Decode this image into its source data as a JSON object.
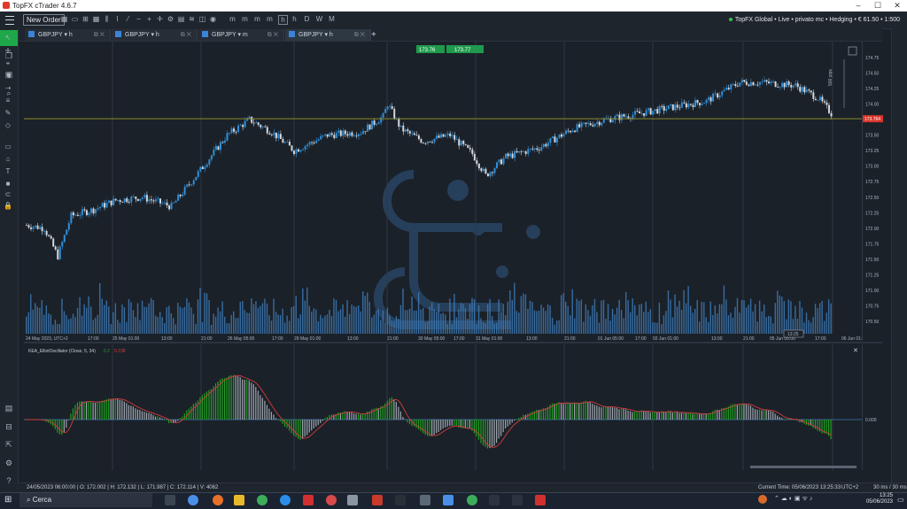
{
  "window": {
    "title": "TopFX cTrader 4.6.7"
  },
  "toolbar": {
    "new_order_label": "New Order",
    "timeframe_buttons": [
      "m",
      "m",
      "m",
      "m",
      "h",
      "h",
      "D",
      "W",
      "M"
    ],
    "account_info": "TopFX Global • Live • privato mc • Hedging • € 61.50 • 1:500"
  },
  "tabs": [
    {
      "symbol": "GBPJPY",
      "tf": "h",
      "active": false
    },
    {
      "symbol": "GBPJPY",
      "tf": "h",
      "active": false
    },
    {
      "symbol": "GBPJPY",
      "tf": "m",
      "active": false
    },
    {
      "symbol": "GBPJPY",
      "tf": "h",
      "active": true
    }
  ],
  "quote": {
    "bid": "173.76",
    "ask": "173.77"
  },
  "price_axis": {
    "labels": [
      "174.75",
      "174.50",
      "174.25",
      "174.00",
      "173.75",
      "173.50",
      "173.25",
      "173.00",
      "172.75",
      "172.50",
      "172.25",
      "172.00",
      "171.75",
      "171.50",
      "171.25",
      "171.00",
      "170.75",
      "170.50"
    ],
    "current_price": "173.764",
    "range_label": "500 pips"
  },
  "time_axis": {
    "labels": [
      "24 May 2023, UTC+2",
      "17:00",
      "25 May 01:00",
      "13:00",
      "21:00",
      "26 May 05:00",
      "17:00",
      "29 May 01:00",
      "13:00",
      "21:00",
      "30 May 05:00",
      "17:00",
      "31 May 01:00",
      "13:00",
      "21:00",
      "01 Jun 05:00",
      "17:00",
      "02 Jun 01:00",
      "13:00",
      "21:00",
      "05 Jun 05:00",
      "17:00",
      "06 Jun 01:00"
    ],
    "hover_label": "13:25"
  },
  "oscillator": {
    "title": "KEA_ElliotOscillator (Close, 5, 34)",
    "value_green": "0.2",
    "value_red": "0.238",
    "zero_label": "0.000"
  },
  "status_bar": {
    "bar_info": "24/05/2023 06:00:00 | O: 172.002 | H: 172.132 | L: 171.987 | C: 172.114 | V: 4062",
    "current_time": "Current Time: 05/06/2023 13:25:33",
    "timezone": "UTC+2",
    "latency": "30 ms / 30 ms"
  },
  "taskbar": {
    "search_placeholder": "Cerca",
    "time": "13:25",
    "date": "05/06/2023"
  },
  "colors": {
    "bull": "#2f8fd8",
    "bear": "#d4d8dd",
    "volume": "#3f7fbf",
    "osc_green": "#20a020",
    "osc_gray": "#9ea5ad",
    "signal_red": "#d23c3c",
    "price_line": "#8a8a2a",
    "price_tag": "#d9352b",
    "quote_tag": "#1f9a4d"
  }
}
